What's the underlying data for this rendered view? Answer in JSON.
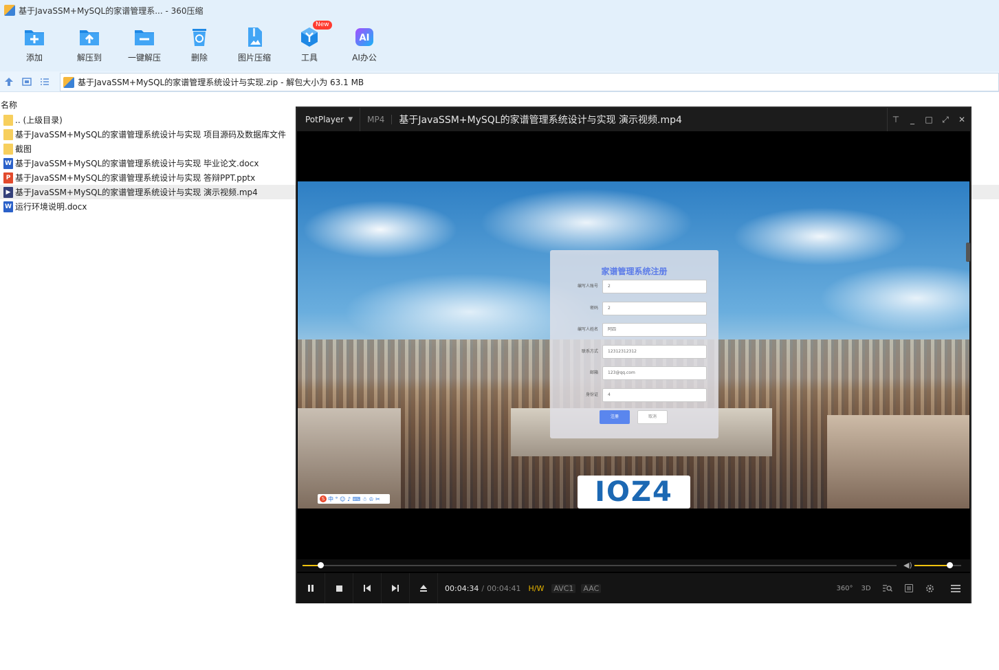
{
  "window": {
    "title": "基于JavaSSM+MySQL的家谱管理系... - 360压缩"
  },
  "toolbar": {
    "items": [
      {
        "label": "添加",
        "icon": "add-icon"
      },
      {
        "label": "解压到",
        "icon": "extract-to-icon"
      },
      {
        "label": "一键解压",
        "icon": "one-click-extract-icon"
      },
      {
        "label": "删除",
        "icon": "delete-icon"
      },
      {
        "label": "图片压缩",
        "icon": "image-compress-icon"
      },
      {
        "label": "工具",
        "icon": "tools-icon",
        "badge": "New"
      },
      {
        "label": "AI办公",
        "icon": "ai-office-icon"
      }
    ]
  },
  "address": {
    "path": "基于JavaSSM+MySQL的家谱管理系统设计与实现.zip - 解包大小为 63.1 MB"
  },
  "filelist": {
    "column_name": "名称",
    "rows": [
      {
        "name": ".. (上级目录)",
        "type": "folder"
      },
      {
        "name": "基于JavaSSM+MySQL的家谱管理系统设计与实现 项目源码及数据库文件",
        "type": "folder"
      },
      {
        "name": "截图",
        "type": "folder"
      },
      {
        "name": "基于JavaSSM+MySQL的家谱管理系统设计与实现 毕业论文.docx",
        "type": "docx"
      },
      {
        "name": "基于JavaSSM+MySQL的家谱管理系统设计与实现 答辩PPT.pptx",
        "type": "pptx"
      },
      {
        "name": "基于JavaSSM+MySQL的家谱管理系统设计与实现 演示视频.mp4",
        "type": "mp4",
        "selected": true
      },
      {
        "name": "运行环境说明.docx",
        "type": "docx"
      }
    ]
  },
  "player": {
    "brand": "PotPlayer",
    "format": "MP4",
    "filename": "基于JavaSSM+MySQL的家谱管理系统设计与实现 演示视频.mp4",
    "current_time": "00:04:34",
    "separator": "/",
    "total_time": "00:04:41",
    "progress": 0.0302,
    "volume": 0.75,
    "tag_hw": "H/W",
    "tag_video": "AVC1",
    "tag_audio": "AAC",
    "right_controls": [
      "360°",
      "3D"
    ],
    "video": {
      "form_title": "家谱管理系统注册",
      "fields": [
        {
          "label": "编写人账号",
          "value": "2"
        },
        {
          "label": "密码",
          "value": "2"
        },
        {
          "label": "编写人姓名",
          "value": "阿四"
        },
        {
          "label": "联系方式",
          "value": "12312312312"
        },
        {
          "label": "邮箱",
          "value": "123@qq.com"
        },
        {
          "label": "身份证",
          "value": "4"
        }
      ],
      "register_label": "注册",
      "cancel_label": "取消",
      "ime_text": "中 ° ☺ ♪ ⌨ ☃ ♔ ✂",
      "logo_text": "IOZ4"
    }
  },
  "colors": {
    "accent_yellow": "#f1c40f",
    "form_title_blue": "#5b7be8",
    "toolbar_bg": "#e3f0fb"
  }
}
